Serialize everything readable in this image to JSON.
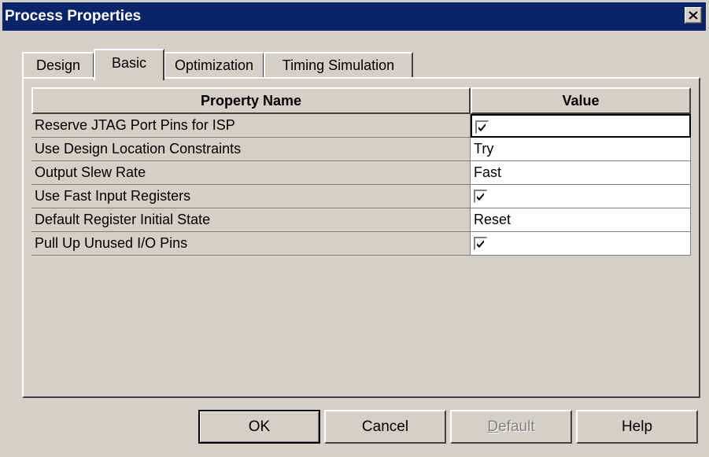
{
  "window": {
    "title": "Process Properties"
  },
  "tabs": [
    {
      "label": "Design"
    },
    {
      "label": "Basic"
    },
    {
      "label": "Optimization"
    },
    {
      "label": "Timing Simulation"
    }
  ],
  "active_tab": "Basic",
  "table": {
    "headers": {
      "name": "Property Name",
      "value": "Value"
    },
    "rows": [
      {
        "name": "Reserve JTAG Port Pins for ISP",
        "value": "",
        "checked": true
      },
      {
        "name": "Use Design Location Constraints",
        "value": "Try"
      },
      {
        "name": "Output Slew Rate",
        "value": "Fast"
      },
      {
        "name": "Use Fast Input Registers",
        "value": "",
        "checked": true
      },
      {
        "name": "Default Register Initial State",
        "value": "Reset"
      },
      {
        "name": "Pull Up Unused I/O Pins",
        "value": "",
        "checked": true
      }
    ]
  },
  "buttons": {
    "ok": "OK",
    "cancel": "Cancel",
    "default_first": "D",
    "default_rest": "efault",
    "help": "Help"
  },
  "colors": {
    "titlebar": "#0a246a",
    "face": "#d4d0c8"
  }
}
